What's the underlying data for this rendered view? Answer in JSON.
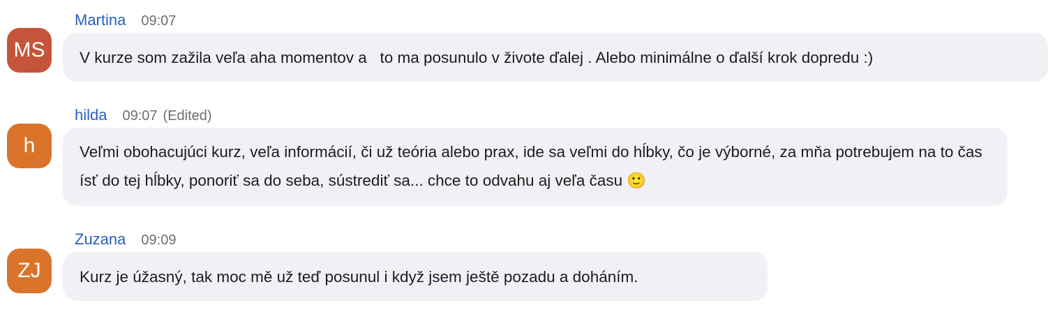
{
  "messages": [
    {
      "initials": "MS",
      "avatar_color": "#c4553a",
      "name": "Martina",
      "time": "09:07",
      "edited": "",
      "text": "V kurze som zažila veľa aha momentov a   to ma posunulo v živote ďalej . Alebo minimálne o ďalší krok dopredu :)"
    },
    {
      "initials": "h",
      "avatar_color": "#d9742a",
      "name": "hilda",
      "time": "09:07",
      "edited": "(Edited)",
      "text": "Veľmi obohacujúci kurz, veľa informácií, či už teória alebo prax, ide sa veľmi do hĺbky, čo je výborné, za mňa potrebujem na to čas ísť do tej hĺbky, ponoriť sa do seba, sústrediť sa... chce to odvahu aj veľa času 🙂"
    },
    {
      "initials": "ZJ",
      "avatar_color": "#d9742a",
      "name": "Zuzana",
      "time": "09:09",
      "edited": "",
      "text": "Kurz je úžasný, tak moc mě už teď posunul i když jsem ještě pozadu a doháním."
    }
  ]
}
